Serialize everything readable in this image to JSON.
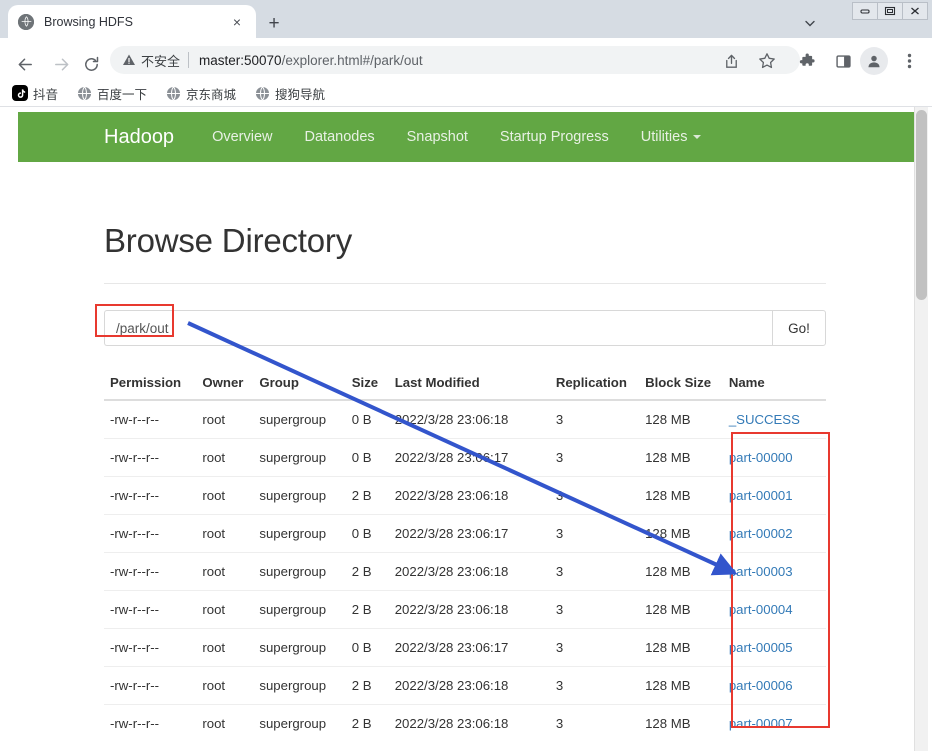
{
  "browser": {
    "tab": {
      "title": "Browsing HDFS",
      "favicon": "globe-icon",
      "close": "×"
    },
    "new_tab_label": "+",
    "tab_list_caret": "⌄",
    "window_controls": {
      "minimize": "minimize-icon",
      "maximize": "maximize-icon",
      "close": "close-icon"
    },
    "nav": {
      "back": "back-arrow-icon",
      "forward": "forward-arrow-icon",
      "reload": "reload-icon"
    },
    "omnibox": {
      "security_icon": "warning-triangle-icon",
      "security_label": "不安全",
      "url_host": "master:50070",
      "url_path": "/explorer.html#/park/out",
      "url_full": "master:50070/explorer.html#/park/out"
    },
    "toolbar_icons": [
      {
        "name": "share-icon",
        "glyph": "share"
      },
      {
        "name": "bookmark-star-icon",
        "glyph": "star"
      },
      {
        "name": "extensions-puzzle-icon",
        "glyph": "puzzle"
      },
      {
        "name": "side-panel-icon",
        "glyph": "panel"
      },
      {
        "name": "profile-avatar-icon",
        "glyph": "person"
      },
      {
        "name": "three-dot-menu-icon",
        "glyph": "kebab"
      }
    ],
    "bookmarks": [
      {
        "label": "抖音",
        "icon": "tiktok-icon"
      },
      {
        "label": "百度一下",
        "icon": "globe-icon"
      },
      {
        "label": "京东商城",
        "icon": "globe-icon"
      },
      {
        "label": "搜狗导航",
        "icon": "globe-icon"
      }
    ]
  },
  "hadoop": {
    "navbar": {
      "brand": "Hadoop",
      "background_color": "#62a744",
      "links": [
        {
          "label": "Overview",
          "has_caret": false
        },
        {
          "label": "Datanodes",
          "has_caret": false
        },
        {
          "label": "Snapshot",
          "has_caret": false
        },
        {
          "label": "Startup Progress",
          "has_caret": false
        },
        {
          "label": "Utilities",
          "has_caret": true
        }
      ]
    },
    "page_title": "Browse Directory",
    "path_input": {
      "value": "/park/out",
      "placeholder": ""
    },
    "go_button": "Go!",
    "table": {
      "headers": [
        "Permission",
        "Owner",
        "Group",
        "Size",
        "Last Modified",
        "Replication",
        "Block Size",
        "Name"
      ],
      "rows": [
        {
          "permission": "-rw-r--r--",
          "owner": "root",
          "group": "supergroup",
          "size": "0 B",
          "modified": "2022/3/28 23:06:18",
          "replication": "3",
          "block_size": "128 MB",
          "name": "_SUCCESS"
        },
        {
          "permission": "-rw-r--r--",
          "owner": "root",
          "group": "supergroup",
          "size": "0 B",
          "modified": "2022/3/28 23:06:17",
          "replication": "3",
          "block_size": "128 MB",
          "name": "part-00000"
        },
        {
          "permission": "-rw-r--r--",
          "owner": "root",
          "group": "supergroup",
          "size": "2 B",
          "modified": "2022/3/28 23:06:18",
          "replication": "3",
          "block_size": "128 MB",
          "name": "part-00001"
        },
        {
          "permission": "-rw-r--r--",
          "owner": "root",
          "group": "supergroup",
          "size": "0 B",
          "modified": "2022/3/28 23:06:17",
          "replication": "3",
          "block_size": "128 MB",
          "name": "part-00002"
        },
        {
          "permission": "-rw-r--r--",
          "owner": "root",
          "group": "supergroup",
          "size": "2 B",
          "modified": "2022/3/28 23:06:18",
          "replication": "3",
          "block_size": "128 MB",
          "name": "part-00003"
        },
        {
          "permission": "-rw-r--r--",
          "owner": "root",
          "group": "supergroup",
          "size": "2 B",
          "modified": "2022/3/28 23:06:18",
          "replication": "3",
          "block_size": "128 MB",
          "name": "part-00004"
        },
        {
          "permission": "-rw-r--r--",
          "owner": "root",
          "group": "supergroup",
          "size": "0 B",
          "modified": "2022/3/28 23:06:17",
          "replication": "3",
          "block_size": "128 MB",
          "name": "part-00005"
        },
        {
          "permission": "-rw-r--r--",
          "owner": "root",
          "group": "supergroup",
          "size": "2 B",
          "modified": "2022/3/28 23:06:18",
          "replication": "3",
          "block_size": "128 MB",
          "name": "part-00006"
        },
        {
          "permission": "-rw-r--r--",
          "owner": "root",
          "group": "supergroup",
          "size": "2 B",
          "modified": "2022/3/28 23:06:18",
          "replication": "3",
          "block_size": "128 MB",
          "name": "part-00007"
        }
      ]
    },
    "link_color": "#337ab7"
  },
  "annotations": {
    "highlight_color": "#e8392f",
    "arrow_color": "#3355cc",
    "path_box": {
      "target": "path-input"
    },
    "name_box": {
      "target": "name-column-part-files"
    },
    "arrow": {
      "from": "path-input",
      "to": "name-column"
    }
  }
}
